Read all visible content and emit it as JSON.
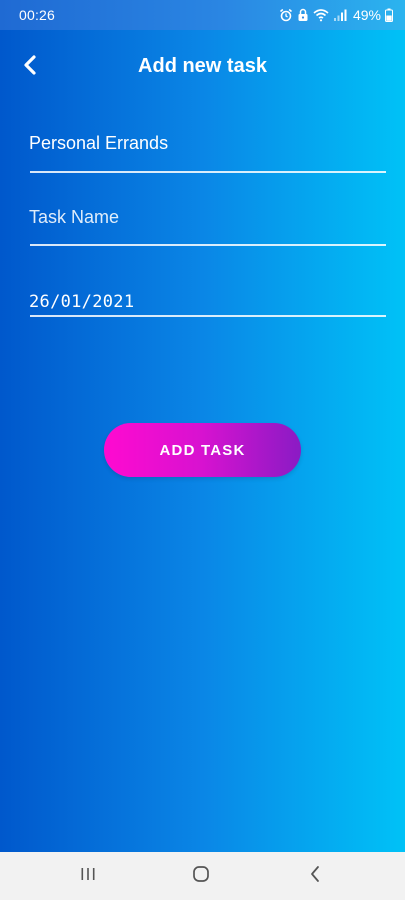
{
  "status_bar": {
    "time": "00:26",
    "battery": "49%",
    "icons": [
      "alarm-icon",
      "lock-icon",
      "wifi-icon",
      "signal-icon",
      "battery-icon"
    ]
  },
  "header": {
    "title": "Add new task",
    "back_icon": "chevron-left-icon"
  },
  "form": {
    "category_value": "Personal Errands",
    "task_name_placeholder": "Task Name",
    "date_value": "26/01/2021"
  },
  "actions": {
    "add_task_label": "ADD TASK"
  },
  "nav_bar": {
    "items": [
      "recents-icon",
      "home-icon",
      "back-icon"
    ]
  },
  "colors": {
    "background_start": "#0058cc",
    "background_end": "#00c2f7",
    "button_start": "#ff0ad0",
    "button_end": "#8a1bc4",
    "nav_background": "#f2f2f2"
  }
}
